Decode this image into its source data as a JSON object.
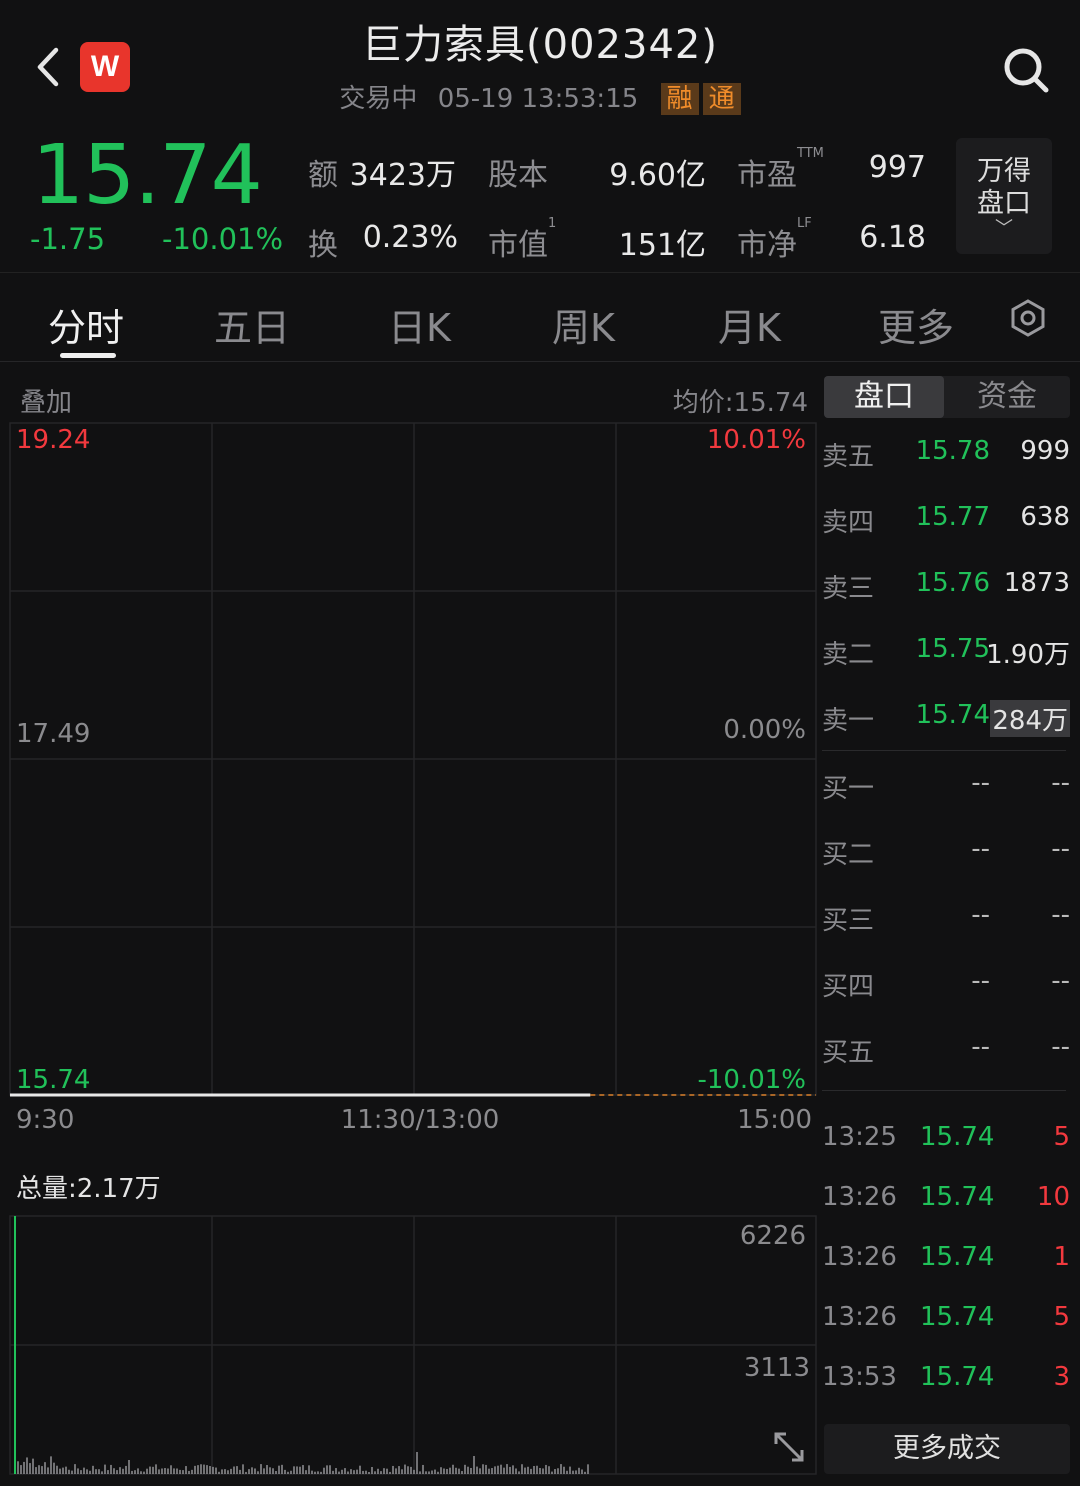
{
  "header": {
    "title": "巨力索具(002342)",
    "status": "交易中",
    "datetime": "05-19 13:53:15",
    "tag_rong": "融",
    "tag_tong": "通",
    "logo_text": "W"
  },
  "quote": {
    "price": "15.74",
    "change": "-1.75",
    "change_pct": "-10.01%",
    "labels": {
      "amount": "额",
      "shares": "股本",
      "pe": "市盈",
      "pe_sup": "TTM",
      "turnover": "换",
      "mktcap": "市值",
      "mktcap_sup": "1",
      "pb": "市净",
      "pb_sup": "LF"
    },
    "values": {
      "amount": "3423万",
      "shares": "9.60亿",
      "pe": "997",
      "turnover": "0.23%",
      "mktcap": "151亿",
      "pb": "6.18"
    },
    "wind_button": "万得盘口"
  },
  "tabs": [
    "分时",
    "五日",
    "日K",
    "周K",
    "月K",
    "更多"
  ],
  "chart": {
    "overlay_label": "叠加",
    "avg_label": "均价:15.74",
    "y_top": "19.24",
    "y_mid": "17.49",
    "y_bottom": "15.74",
    "pct_top": "10.01%",
    "pct_mid": "0.00%",
    "pct_bottom": "-10.01%",
    "x_start": "9:30",
    "x_mid": "11:30/13:00",
    "x_end": "15:00",
    "volume_label": "总量:2.17万",
    "vol_top": "6226",
    "vol_mid": "3113"
  },
  "chart_data": {
    "type": "line",
    "title": "",
    "ylim": [
      15.74,
      19.24
    ],
    "series": [
      {
        "values": [
          15.74,
          15.74,
          15.74,
          15.74,
          15.74,
          15.74
        ]
      }
    ],
    "progress_fraction": 0.72,
    "volume_ylim": [
      0,
      6226
    ]
  },
  "orderbook": {
    "tab_pankou": "盘口",
    "tab_zijin": "资金",
    "asks": [
      {
        "label": "卖五",
        "price": "15.78",
        "vol": "999"
      },
      {
        "label": "卖四",
        "price": "15.77",
        "vol": "638"
      },
      {
        "label": "卖三",
        "price": "15.76",
        "vol": "1873"
      },
      {
        "label": "卖二",
        "price": "15.75",
        "vol": "1.90万"
      },
      {
        "label": "卖一",
        "price": "15.74",
        "vol": "284万"
      }
    ],
    "bids": [
      {
        "label": "买一",
        "price": "--",
        "vol": "--"
      },
      {
        "label": "买二",
        "price": "--",
        "vol": "--"
      },
      {
        "label": "买三",
        "price": "--",
        "vol": "--"
      },
      {
        "label": "买四",
        "price": "--",
        "vol": "--"
      },
      {
        "label": "买五",
        "price": "--",
        "vol": "--"
      }
    ]
  },
  "trades": [
    {
      "time": "13:25",
      "price": "15.74",
      "vol": "5"
    },
    {
      "time": "13:26",
      "price": "15.74",
      "vol": "10"
    },
    {
      "time": "13:26",
      "price": "15.74",
      "vol": "1"
    },
    {
      "time": "13:26",
      "price": "15.74",
      "vol": "5"
    },
    {
      "time": "13:53",
      "price": "15.74",
      "vol": "3"
    }
  ],
  "more_trades_label": "更多成交"
}
